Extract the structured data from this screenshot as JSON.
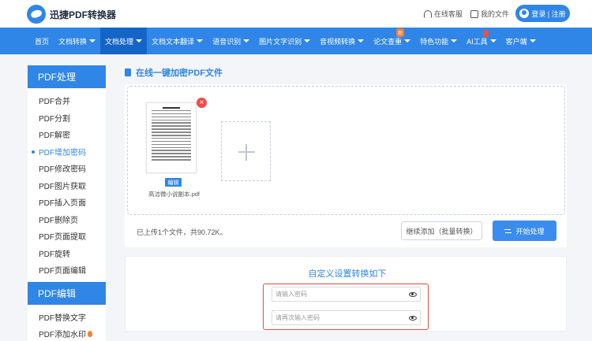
{
  "header": {
    "logo_text": "迅捷PDF转换器",
    "service_label": "在线客服",
    "my_files_label": "我的文件",
    "login_label": "登录 | 注册"
  },
  "nav": {
    "items": [
      {
        "label": "首页",
        "has_caret": false
      },
      {
        "label": "文档转换",
        "has_caret": true
      },
      {
        "label": "文档处理",
        "has_caret": true
      },
      {
        "label": "文档文本翻译",
        "has_caret": true
      },
      {
        "label": "语音识别",
        "has_caret": true
      },
      {
        "label": "图片文字识别",
        "has_caret": true
      },
      {
        "label": "音视频转换",
        "has_caret": true
      },
      {
        "label": "论文查重",
        "has_caret": true
      },
      {
        "label": "特色功能",
        "has_caret": true
      },
      {
        "label": "AI工具",
        "has_caret": true
      },
      {
        "label": "客户端",
        "has_caret": true
      }
    ],
    "active": "文档处理",
    "badge_new": "新"
  },
  "sidebar": {
    "section1_title": "PDF处理",
    "section1_items": [
      "PDF合并",
      "PDF分割",
      "PDF解密",
      "PDF增加密码",
      "PDF修改密码",
      "PDF图片获取",
      "PDF插入页面",
      "PDF删除页",
      "PDF页面提取",
      "PDF旋转",
      "PDF页面编辑"
    ],
    "active_item": "PDF增加密码",
    "section2_title": "PDF编辑",
    "section2_items": [
      "PDF替换文字",
      "PDF添加水印"
    ]
  },
  "main": {
    "title": "在线一键加密PDF文件",
    "file": {
      "name": "高洁微小说副本.pdf",
      "edit_label": "编辑"
    },
    "status_text": "已上传1个文件，共90.72K。",
    "continue_button": "继续添加（批量转换）",
    "start_button": "开始处理"
  },
  "settings": {
    "title": "自定义设置转换如下",
    "password_placeholder": "请输入密码",
    "confirm_placeholder": "请再次输入密码"
  },
  "colors": {
    "brand": "#2f86e6",
    "nav_active": "#1565c9",
    "highlight_border": "#e04b3e"
  }
}
